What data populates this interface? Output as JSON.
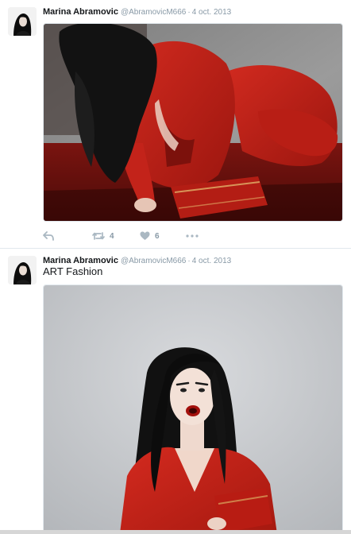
{
  "tweets": [
    {
      "author_name": "Marina Abramovic",
      "handle": "@AbramovicM666",
      "separator": "·",
      "date": "4 oct. 2013",
      "text": "",
      "actions": {
        "reply_icon": "reply-arrow-icon",
        "retweet_icon": "retweet-icon",
        "retweet_count": "4",
        "like_icon": "heart-icon",
        "like_count": "6",
        "more_icon": "more-dots-icon"
      }
    },
    {
      "author_name": "Marina Abramovic",
      "handle": "@AbramovicM666",
      "separator": "·",
      "date": "4 oct. 2013",
      "text": "ART Fashion"
    }
  ],
  "colors": {
    "name": "#14171a",
    "meta": "#8899a6",
    "divider": "#e1e8ed",
    "accent_red": "#c8211b"
  }
}
